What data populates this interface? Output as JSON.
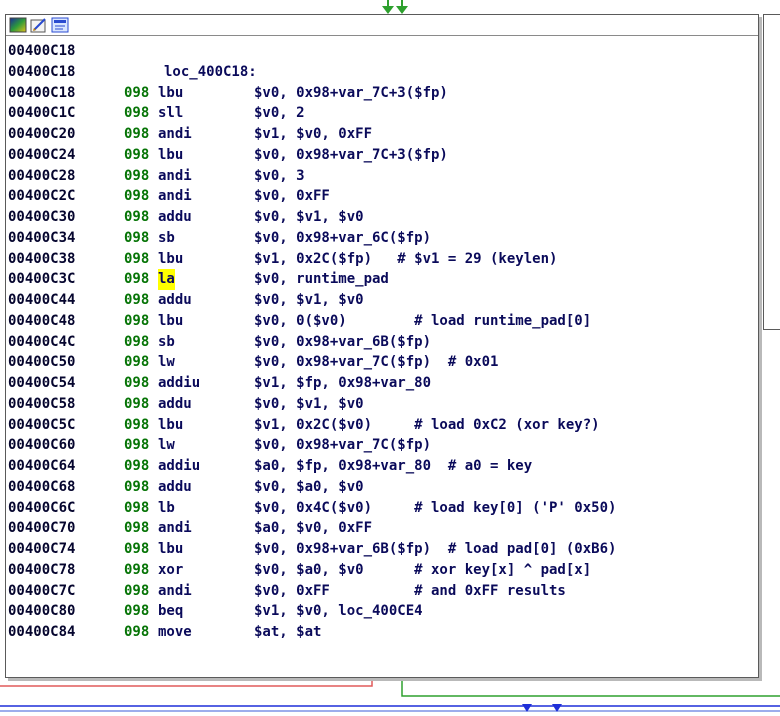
{
  "toolbar": {
    "icons": [
      "color-icon",
      "edit-icon",
      "graph-overview-icon"
    ]
  },
  "code": {
    "lines": [
      {
        "addr": "00400C18",
        "sp": "",
        "mn": "",
        "ops": "",
        "label": ""
      },
      {
        "addr": "00400C18",
        "sp": "",
        "mn": "",
        "ops": "",
        "label": "loc_400C18:"
      },
      {
        "addr": "00400C18",
        "sp": "098",
        "mn": "lbu",
        "ops": "$v0, 0x98+var_7C+3($fp)",
        "label": ""
      },
      {
        "addr": "00400C1C",
        "sp": "098",
        "mn": "sll",
        "ops": "$v0, 2",
        "label": ""
      },
      {
        "addr": "00400C20",
        "sp": "098",
        "mn": "andi",
        "ops": "$v1, $v0, 0xFF",
        "label": ""
      },
      {
        "addr": "00400C24",
        "sp": "098",
        "mn": "lbu",
        "ops": "$v0, 0x98+var_7C+3($fp)",
        "label": ""
      },
      {
        "addr": "00400C28",
        "sp": "098",
        "mn": "andi",
        "ops": "$v0, 3",
        "label": ""
      },
      {
        "addr": "00400C2C",
        "sp": "098",
        "mn": "andi",
        "ops": "$v0, 0xFF",
        "label": ""
      },
      {
        "addr": "00400C30",
        "sp": "098",
        "mn": "addu",
        "ops": "$v0, $v1, $v0",
        "label": ""
      },
      {
        "addr": "00400C34",
        "sp": "098",
        "mn": "sb",
        "ops": "$v0, 0x98+var_6C($fp)",
        "label": ""
      },
      {
        "addr": "00400C38",
        "sp": "098",
        "mn": "lbu",
        "ops": "$v1, 0x2C($fp)   # $v1 = 29 (keylen)",
        "label": ""
      },
      {
        "addr": "00400C3C",
        "sp": "098",
        "mn": "la",
        "ops": "$v0, runtime_pad",
        "label": "",
        "highlight": true
      },
      {
        "addr": "00400C44",
        "sp": "098",
        "mn": "addu",
        "ops": "$v0, $v1, $v0",
        "label": ""
      },
      {
        "addr": "00400C48",
        "sp": "098",
        "mn": "lbu",
        "ops": "$v0, 0($v0)        # load runtime_pad[0]",
        "label": ""
      },
      {
        "addr": "00400C4C",
        "sp": "098",
        "mn": "sb",
        "ops": "$v0, 0x98+var_6B($fp)",
        "label": ""
      },
      {
        "addr": "00400C50",
        "sp": "098",
        "mn": "lw",
        "ops": "$v0, 0x98+var_7C($fp)  # 0x01",
        "label": ""
      },
      {
        "addr": "00400C54",
        "sp": "098",
        "mn": "addiu",
        "ops": "$v1, $fp, 0x98+var_80",
        "label": ""
      },
      {
        "addr": "00400C58",
        "sp": "098",
        "mn": "addu",
        "ops": "$v0, $v1, $v0",
        "label": ""
      },
      {
        "addr": "00400C5C",
        "sp": "098",
        "mn": "lbu",
        "ops": "$v1, 0x2C($v0)     # load 0xC2 (xor key?)",
        "label": ""
      },
      {
        "addr": "00400C60",
        "sp": "098",
        "mn": "lw",
        "ops": "$v0, 0x98+var_7C($fp)",
        "label": ""
      },
      {
        "addr": "00400C64",
        "sp": "098",
        "mn": "addiu",
        "ops": "$a0, $fp, 0x98+var_80  # a0 = key",
        "label": ""
      },
      {
        "addr": "00400C68",
        "sp": "098",
        "mn": "addu",
        "ops": "$v0, $a0, $v0",
        "label": ""
      },
      {
        "addr": "00400C6C",
        "sp": "098",
        "mn": "lb",
        "ops": "$v0, 0x4C($v0)     # load key[0] ('P' 0x50)",
        "label": ""
      },
      {
        "addr": "00400C70",
        "sp": "098",
        "mn": "andi",
        "ops": "$a0, $v0, 0xFF",
        "label": ""
      },
      {
        "addr": "00400C74",
        "sp": "098",
        "mn": "lbu",
        "ops": "$v0, 0x98+var_6B($fp)  # load pad[0] (0xB6)",
        "label": ""
      },
      {
        "addr": "00400C78",
        "sp": "098",
        "mn": "xor",
        "ops": "$v0, $a0, $v0      # xor key[x] ^ pad[x]",
        "label": ""
      },
      {
        "addr": "00400C7C",
        "sp": "098",
        "mn": "andi",
        "ops": "$v0, 0xFF          # and 0xFF results",
        "label": ""
      },
      {
        "addr": "00400C80",
        "sp": "098",
        "mn": "beq",
        "ops": "$v1, $v0, loc_400CE4",
        "label": ""
      },
      {
        "addr": "00400C84",
        "sp": "098",
        "mn": "move",
        "ops": "$at, $at",
        "label": ""
      }
    ]
  },
  "colors": {
    "edge_true": "#2ea02e",
    "edge_false": "#e05a5a",
    "edge_ref": "#1f2fd8"
  }
}
